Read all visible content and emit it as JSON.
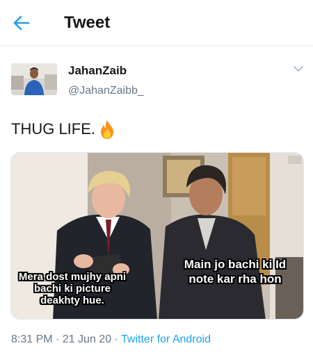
{
  "header": {
    "title": "Tweet",
    "back_icon": "arrow-left-icon"
  },
  "colors": {
    "accent": "#1da1f2",
    "text_primary": "#14171a",
    "text_secondary": "#657786",
    "divider": "#e6ecf0"
  },
  "tweet": {
    "author": {
      "display_name": "JahanZaib",
      "handle": "@JahanZaibb_",
      "avatar_icon": "avatar-photo"
    },
    "text": "THUG LIFE.",
    "emoji_icon": "fire-icon",
    "media": {
      "caption_left": "Mera dost mujhy apni bachi ki picture deakhty hue.",
      "caption_right": "Main jo bachi ki Id note kar rha hon"
    },
    "time": "8:31 PM",
    "separator_1": " · ",
    "date": "21 Jun 20",
    "separator_2": " · ",
    "source": "Twitter for Android",
    "menu_icon": "chevron-down-icon"
  }
}
